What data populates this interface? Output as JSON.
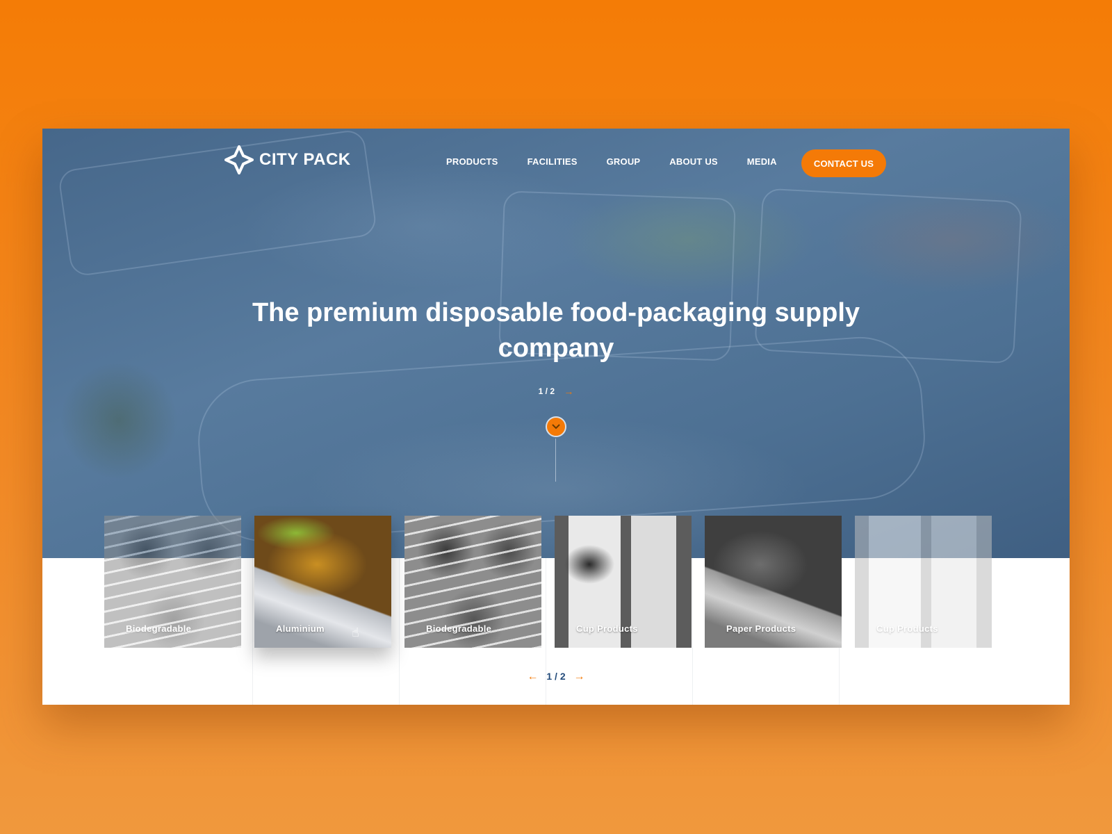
{
  "brand": {
    "name": "CITY PACK"
  },
  "nav": {
    "items": [
      "PRODUCTS",
      "FACILITIES",
      "GROUP",
      "ABOUT US",
      "MEDIA"
    ],
    "contact": "CONTACT US"
  },
  "hero": {
    "headline": "The premium disposable food-packaging supply company",
    "pager": "1 / 2"
  },
  "products": {
    "cards": [
      {
        "label": "Biodegradable"
      },
      {
        "label": "Aluminium"
      },
      {
        "label": "Biodegradable"
      },
      {
        "label": "Cup Products"
      },
      {
        "label": "Paper Products"
      },
      {
        "label": "Cup Products"
      }
    ],
    "pager": "1 / 2"
  },
  "colors": {
    "accent": "#f47a07",
    "hero_tint": "#4a6d91",
    "pager_text": "#234b7a"
  }
}
